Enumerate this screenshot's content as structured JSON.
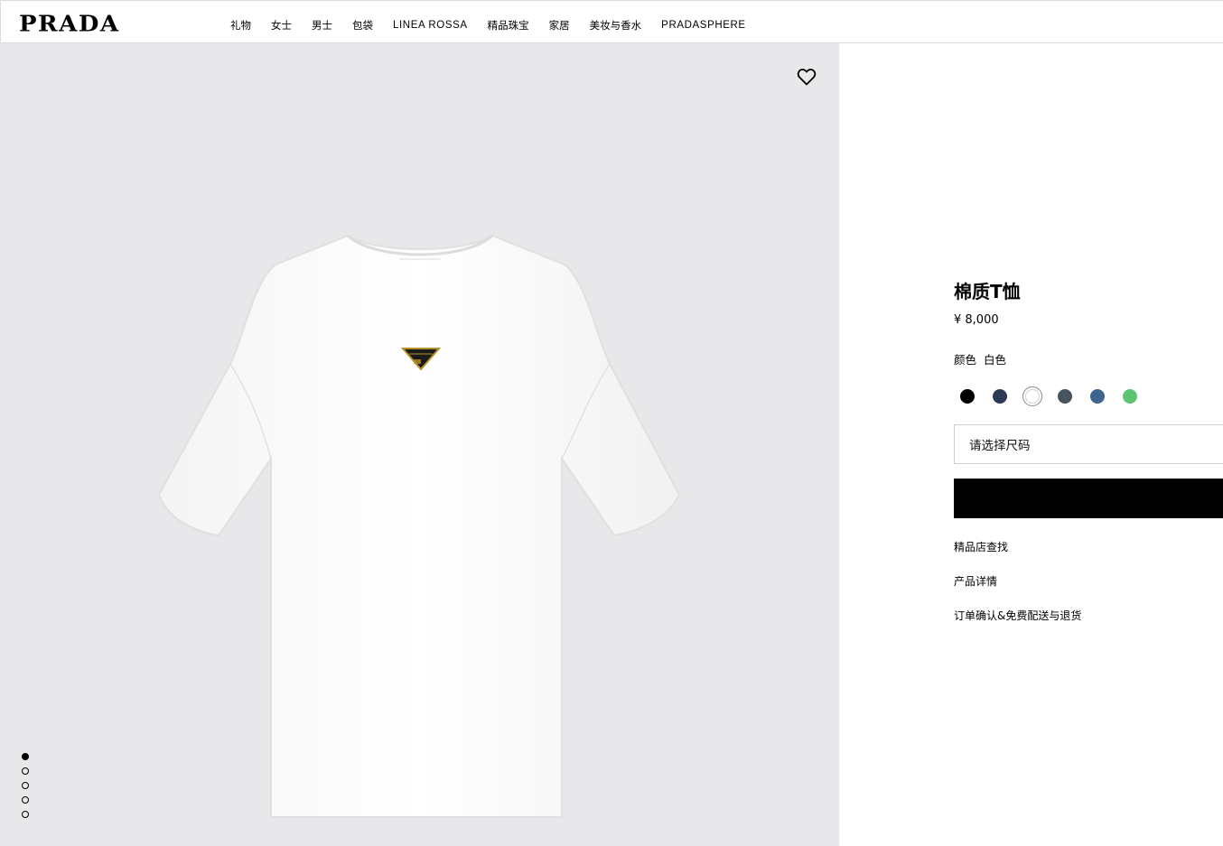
{
  "header": {
    "logo": "PRADA",
    "nav": [
      {
        "label": "礼物"
      },
      {
        "label": "女士"
      },
      {
        "label": "男士"
      },
      {
        "label": "包袋"
      },
      {
        "label": "LINEA ROSSA"
      },
      {
        "label": "精品珠宝"
      },
      {
        "label": "家居"
      },
      {
        "label": "美妆与香水"
      },
      {
        "label": "PRADASPHERE"
      }
    ]
  },
  "gallery": {
    "wishlist_icon": "heart-outline-icon",
    "image_count": 5,
    "active_index": 0,
    "background": "#e8e8ea"
  },
  "product": {
    "title": "棉质T恤",
    "price": "¥ 8,000",
    "color_label": "颜色",
    "color_value": "白色",
    "swatches": [
      {
        "color": "#000000",
        "selected": false
      },
      {
        "color": "#2b3a55",
        "selected": false
      },
      {
        "color": "#ffffff",
        "selected": true
      },
      {
        "color": "#46545f",
        "selected": false
      },
      {
        "color": "#3e6590",
        "selected": false
      },
      {
        "color": "#5dc472",
        "selected": false
      }
    ],
    "size_placeholder": "请选择尺码",
    "links": [
      "精品店查找",
      "产品详情",
      "订单确认&免费配送与退货"
    ]
  }
}
